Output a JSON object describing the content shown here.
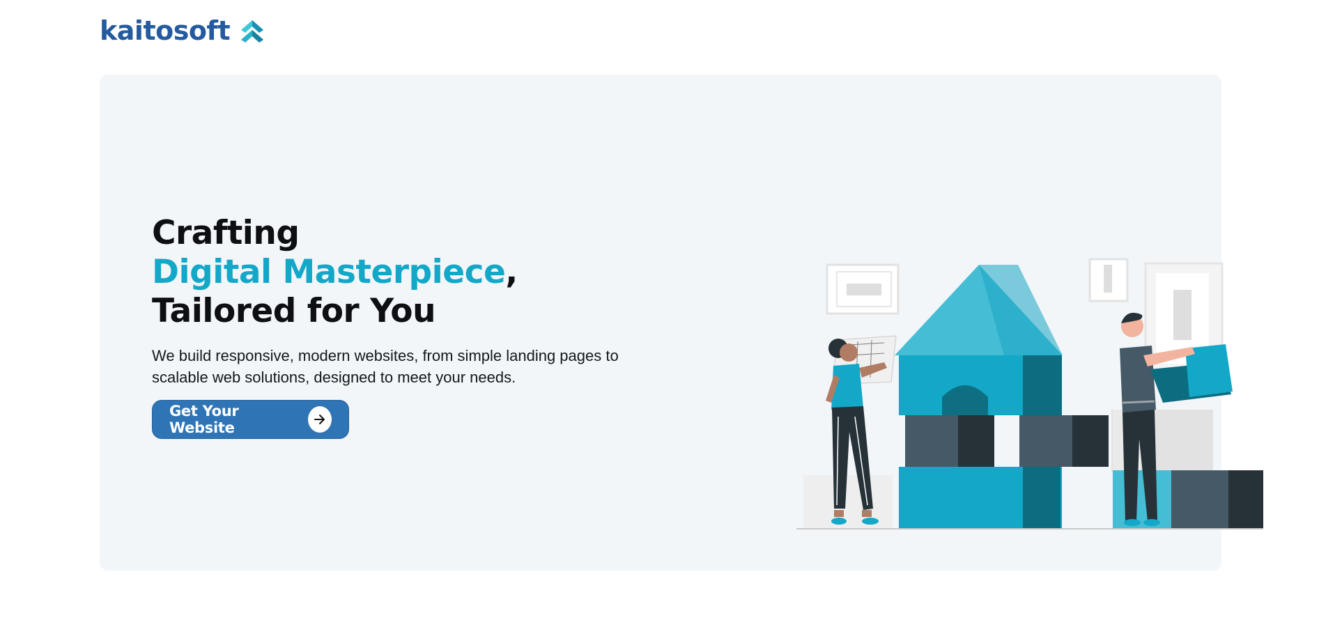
{
  "header": {
    "brand": "kaitosoft",
    "logo_icon": "double-chevron-up-icon"
  },
  "hero": {
    "title_line1": "Crafting",
    "title_accent": "Digital Masterpiece",
    "title_comma": ",",
    "title_line3": "Tailored for You",
    "subtitle": "We build responsive, modern websites, from simple landing pages to scalable web solutions, designed to meet your needs.",
    "cta_label": "Get Your Website",
    "cta_icon": "arrow-right-icon",
    "illustration": "building-blocks-house-illustration"
  },
  "colors": {
    "brand": "#245a9e",
    "accent": "#14a8c8",
    "button": "#2f74b5",
    "hero_bg": "#f2f6f9"
  }
}
